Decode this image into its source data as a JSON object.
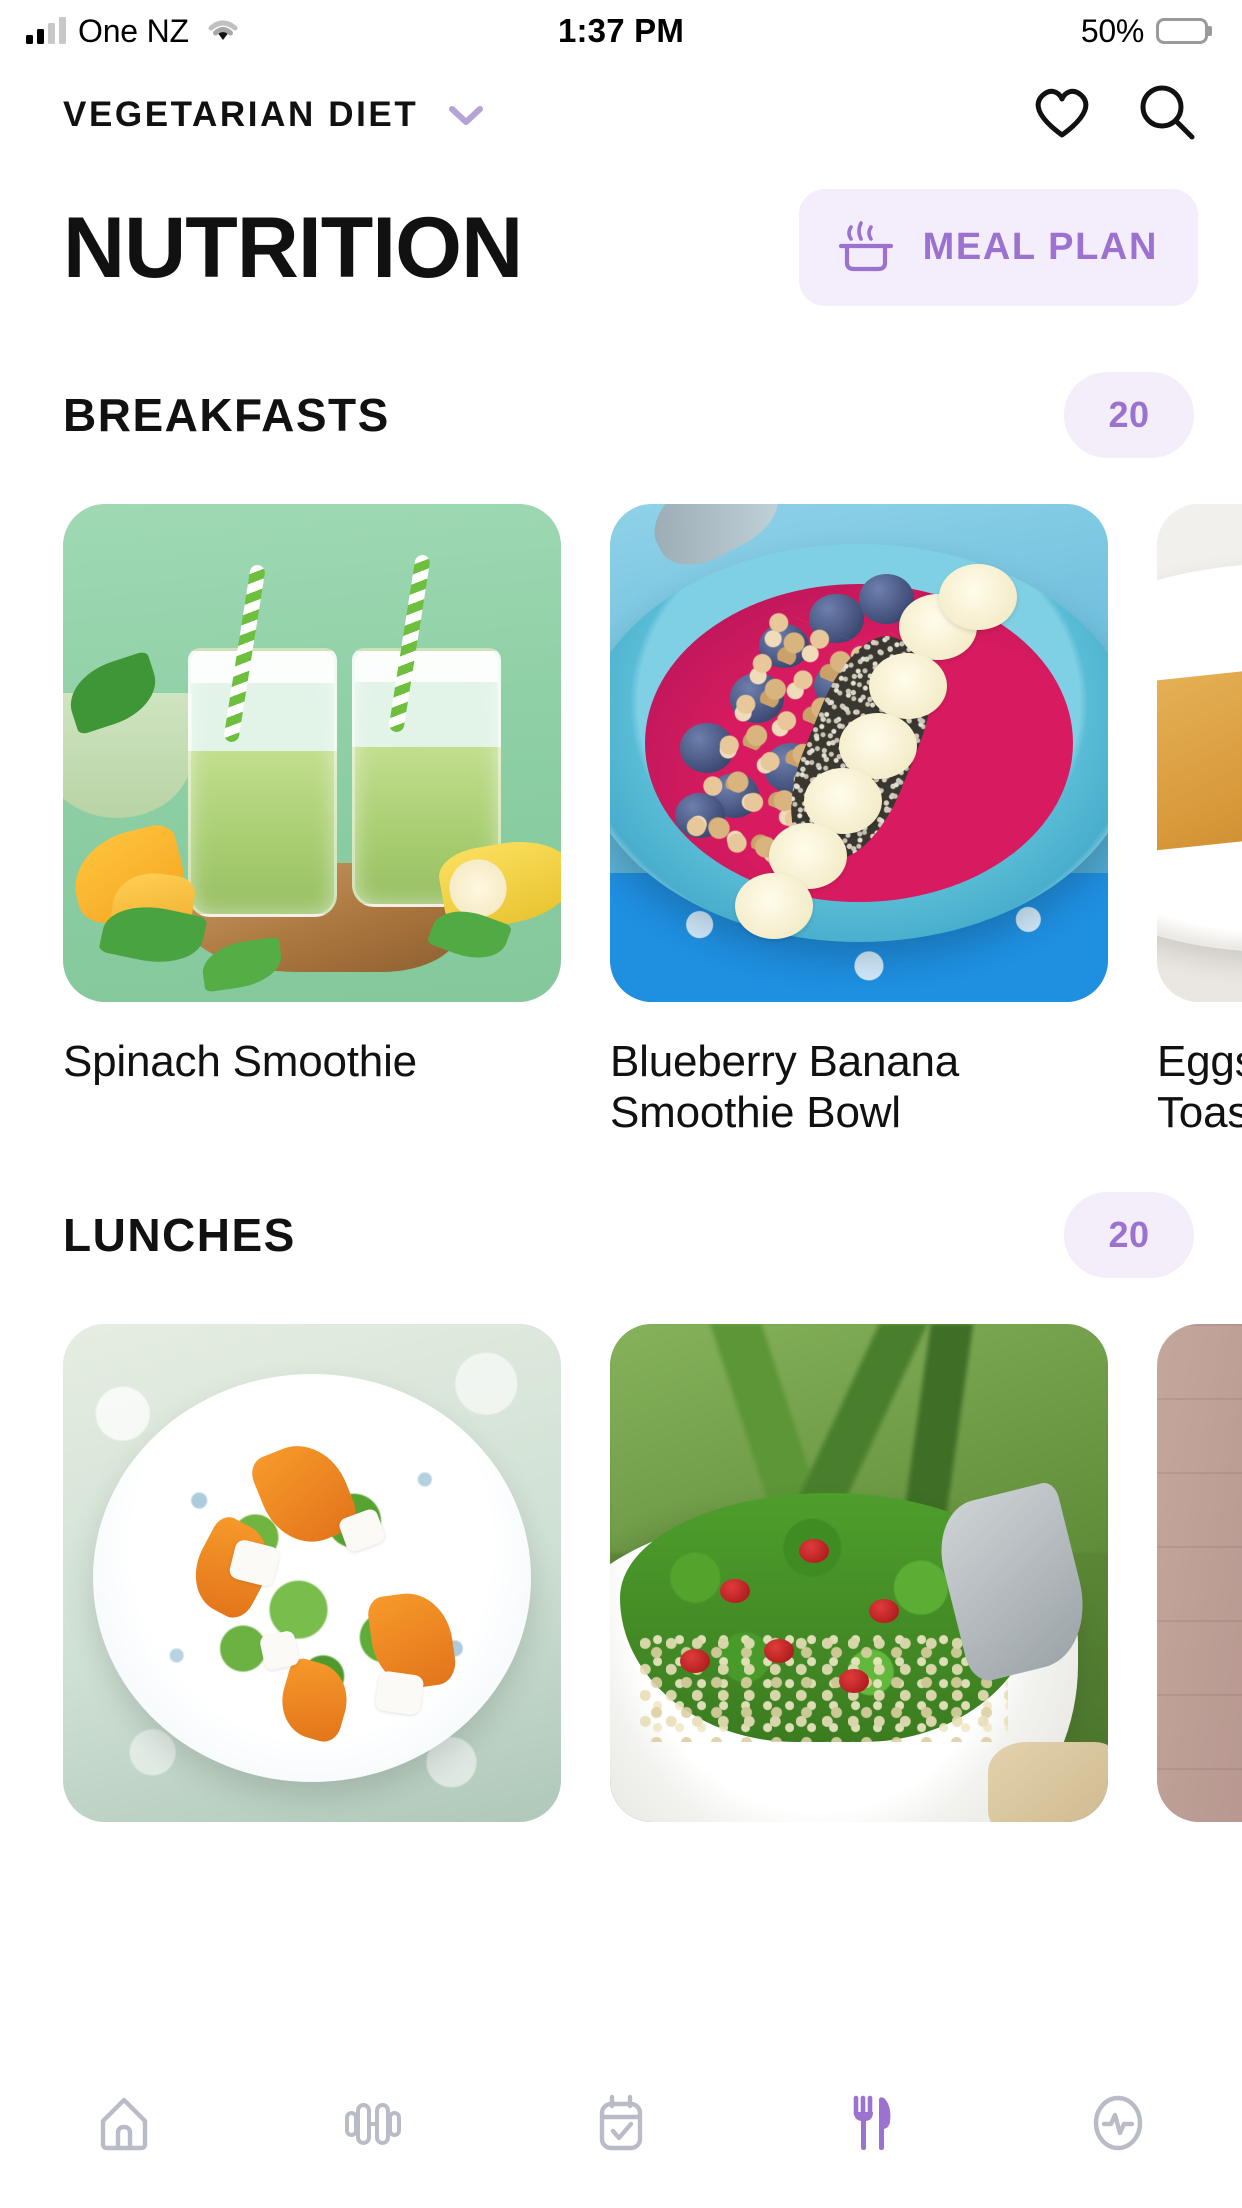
{
  "status_bar": {
    "carrier": "One NZ",
    "signal_icon": "cellular-signal-icon",
    "wifi_icon": "wifi-icon",
    "time": "1:37 PM",
    "battery_percent": "50%",
    "battery_icon": "battery-half-icon",
    "battery_level": 50
  },
  "app_bar": {
    "diet_label": "VEGETARIAN DIET",
    "chevron_icon": "chevron-down-icon",
    "favorites_icon": "heart-icon",
    "search_icon": "search-icon"
  },
  "page": {
    "title": "NUTRITION",
    "meal_plan": {
      "label": "MEAL PLAN",
      "icon": "cooking-pot-icon"
    }
  },
  "sections": [
    {
      "title": "BREAKFASTS",
      "count": "20",
      "cards": [
        {
          "name": "Spinach Smoothie",
          "image": "spinach-smoothie-photo"
        },
        {
          "name": "Blueberry Banana Smoothie Bowl",
          "image": "blueberry-banana-smoothie-bowl-photo"
        },
        {
          "name": "Eggs\nToast",
          "image": "eggs-on-toast-photo"
        }
      ]
    },
    {
      "title": "LUNCHES",
      "count": "20",
      "cards": [
        {
          "name": "",
          "image": "pumpkin-feta-salad-photo"
        },
        {
          "name": "",
          "image": "kale-quinoa-salad-photo"
        },
        {
          "name": "",
          "image": "wood-board-photo"
        }
      ]
    }
  ],
  "tab_bar": {
    "items": [
      {
        "icon": "home-icon",
        "active": false
      },
      {
        "icon": "dumbbell-icon",
        "active": false
      },
      {
        "icon": "calendar-check-icon",
        "active": false
      },
      {
        "icon": "fork-knife-icon",
        "active": true
      },
      {
        "icon": "activity-pulse-icon",
        "active": false
      }
    ]
  },
  "colors": {
    "accent_purple": "#9B72CF",
    "accent_soft": "#F4EDFC",
    "badge_bg": "#F3EEFA",
    "text_dark": "#111111",
    "nav_inactive": "#B9BCC6"
  }
}
